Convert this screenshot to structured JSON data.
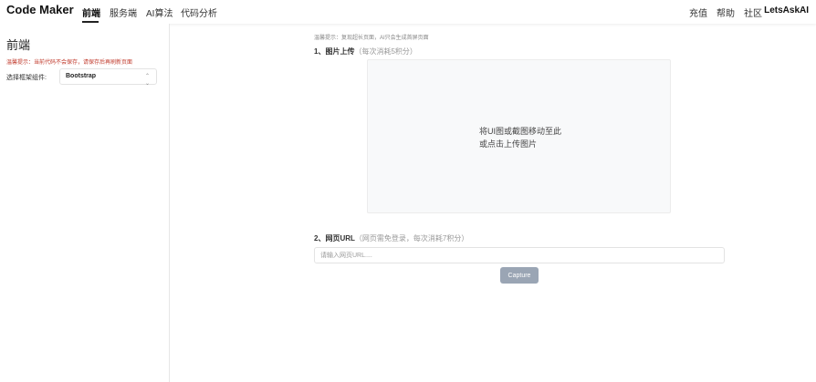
{
  "nav": {
    "brand": "Code Maker",
    "tabs": [
      {
        "label": "前端",
        "active": true
      },
      {
        "label": "服务端",
        "active": false
      },
      {
        "label": "AI算法",
        "active": false
      },
      {
        "label": "代码分析",
        "active": false
      }
    ],
    "right": [
      "充值",
      "帮助",
      "社区"
    ],
    "user": "LetsAskAI"
  },
  "sidebar": {
    "title": "前端",
    "warning": "温馨提示：当前代码不会保存，请保存后再刷新页面",
    "framework_label": "选择框架组件:",
    "framework_value": "Bootstrap"
  },
  "main": {
    "tip": "温馨提示：复现超长页面，AI只会生成首屏页面",
    "upload": {
      "title": "1、图片上传",
      "note": "（每次消耗5积分）",
      "hint_line1": "将UI图或截图移动至此",
      "hint_line2": "或点击上传图片"
    },
    "url": {
      "title": "2、网页URL",
      "note": "（网页需免登录，每次消耗7积分）",
      "placeholder": "请输入网页URL....",
      "button": "Capture"
    }
  },
  "colors": {
    "warning": "#c0392b",
    "capture_button": "#9aa5b4",
    "upload_bg": "#f8f9fa"
  }
}
